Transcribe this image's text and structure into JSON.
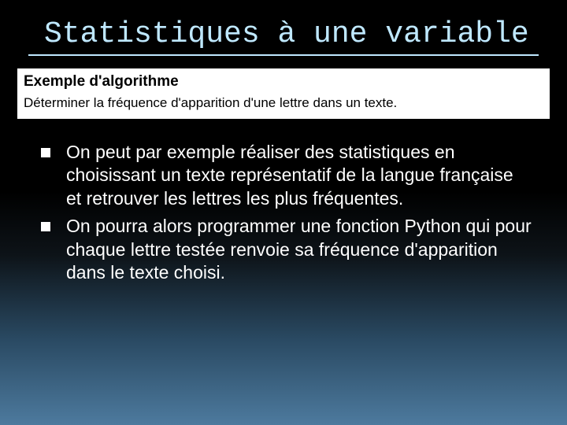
{
  "title": "Statistiques à une variable",
  "whitebox": {
    "heading": "Exemple d'algorithme",
    "sub": "Déterminer la fréquence d'apparition d'une lettre dans un texte."
  },
  "bullets": [
    "On peut par exemple réaliser des statistiques en choisissant un texte représentatif de la langue française et retrouver les lettres les plus fréquentes.",
    " On pourra alors programmer une fonction Python qui pour chaque lettre testée renvoie sa fréquence d'apparition dans le texte choisi."
  ]
}
